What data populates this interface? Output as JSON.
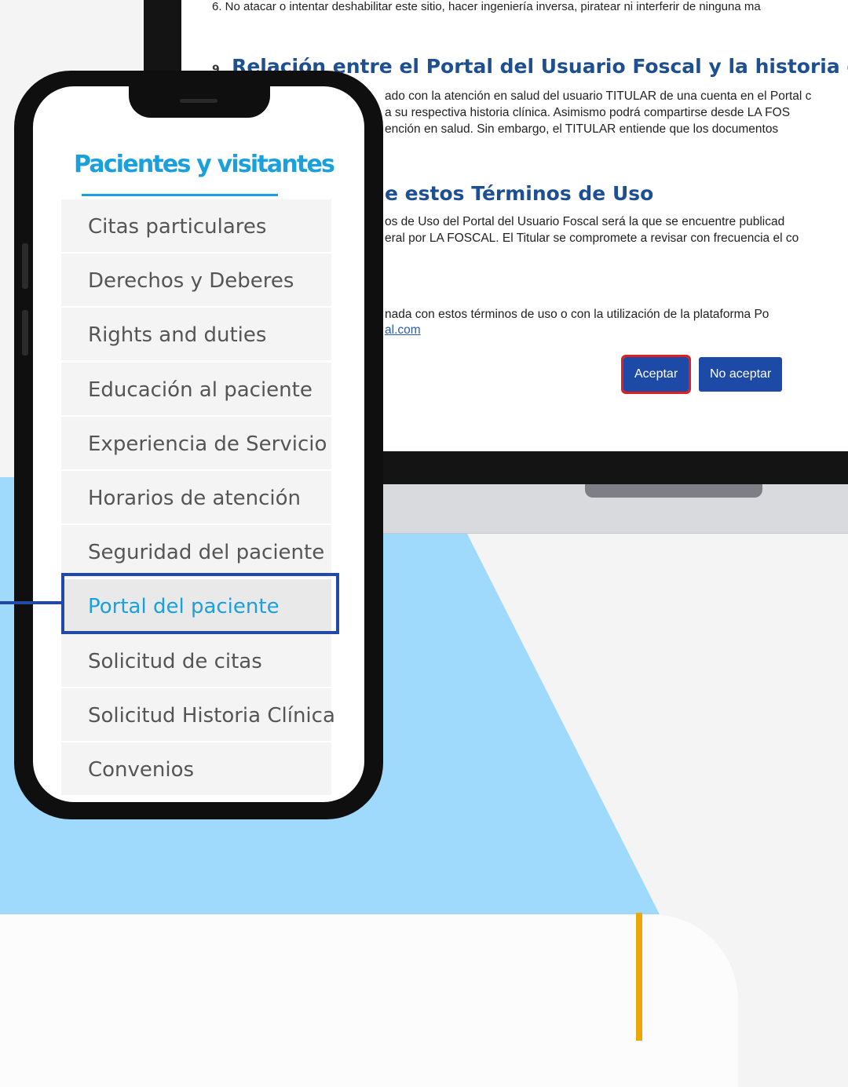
{
  "document": {
    "rule_line": "6.  No atacar o intentar deshabilitar este sitio, hacer ingeniería inversa, piratear ni interferir de ninguna ma",
    "heading_relation": "Relación entre el Portal del Usuario Foscal y la historia clínica",
    "para_relation": [
      "ado con la atención en salud del usuario TITULAR de una cuenta en el Portal c",
      "a su respectiva historia clínica.  Asimismo podrá compartirse desde LA FOS",
      "ención en salud.  Sin embargo, el TITULAR entiende que los documentos"
    ],
    "heading_terms": "e estos Términos de Uso",
    "para_terms": [
      "os de Uso del Portal del Usuario Foscal será la que se encuentre publicad",
      "eral por LA FOSCAL.  El Titular se compromete a revisar con frecuencia el co"
    ],
    "para_contact": "nada con estos términos de uso o con la utilización de la plataforma Po",
    "link_text": "al.com",
    "accept_label": "Aceptar",
    "decline_label": "No aceptar"
  },
  "menu": {
    "title": "Pacientes y visitantes",
    "items": [
      {
        "label": "Citas particulares"
      },
      {
        "label": "Derechos y Deberes"
      },
      {
        "label": "Rights and duties"
      },
      {
        "label": "Educación al paciente"
      },
      {
        "label": "Experiencia de Servicio"
      },
      {
        "label": "Horarios de atención"
      },
      {
        "label": "Seguridad del paciente"
      },
      {
        "label": "Portal del paciente",
        "active": true
      },
      {
        "label": "Solicitud de citas"
      },
      {
        "label": "Solicitud Historia Clínica"
      },
      {
        "label": "Convenios"
      }
    ]
  },
  "colors": {
    "accent_blue": "#1aa0dc",
    "highlight_border": "#2349a6",
    "heading_blue": "#1d4f91",
    "button_blue": "#1d4aa7",
    "accept_outline": "#e02020",
    "background_light_blue": "#9fdafc",
    "orange_line": "#eda60a"
  }
}
